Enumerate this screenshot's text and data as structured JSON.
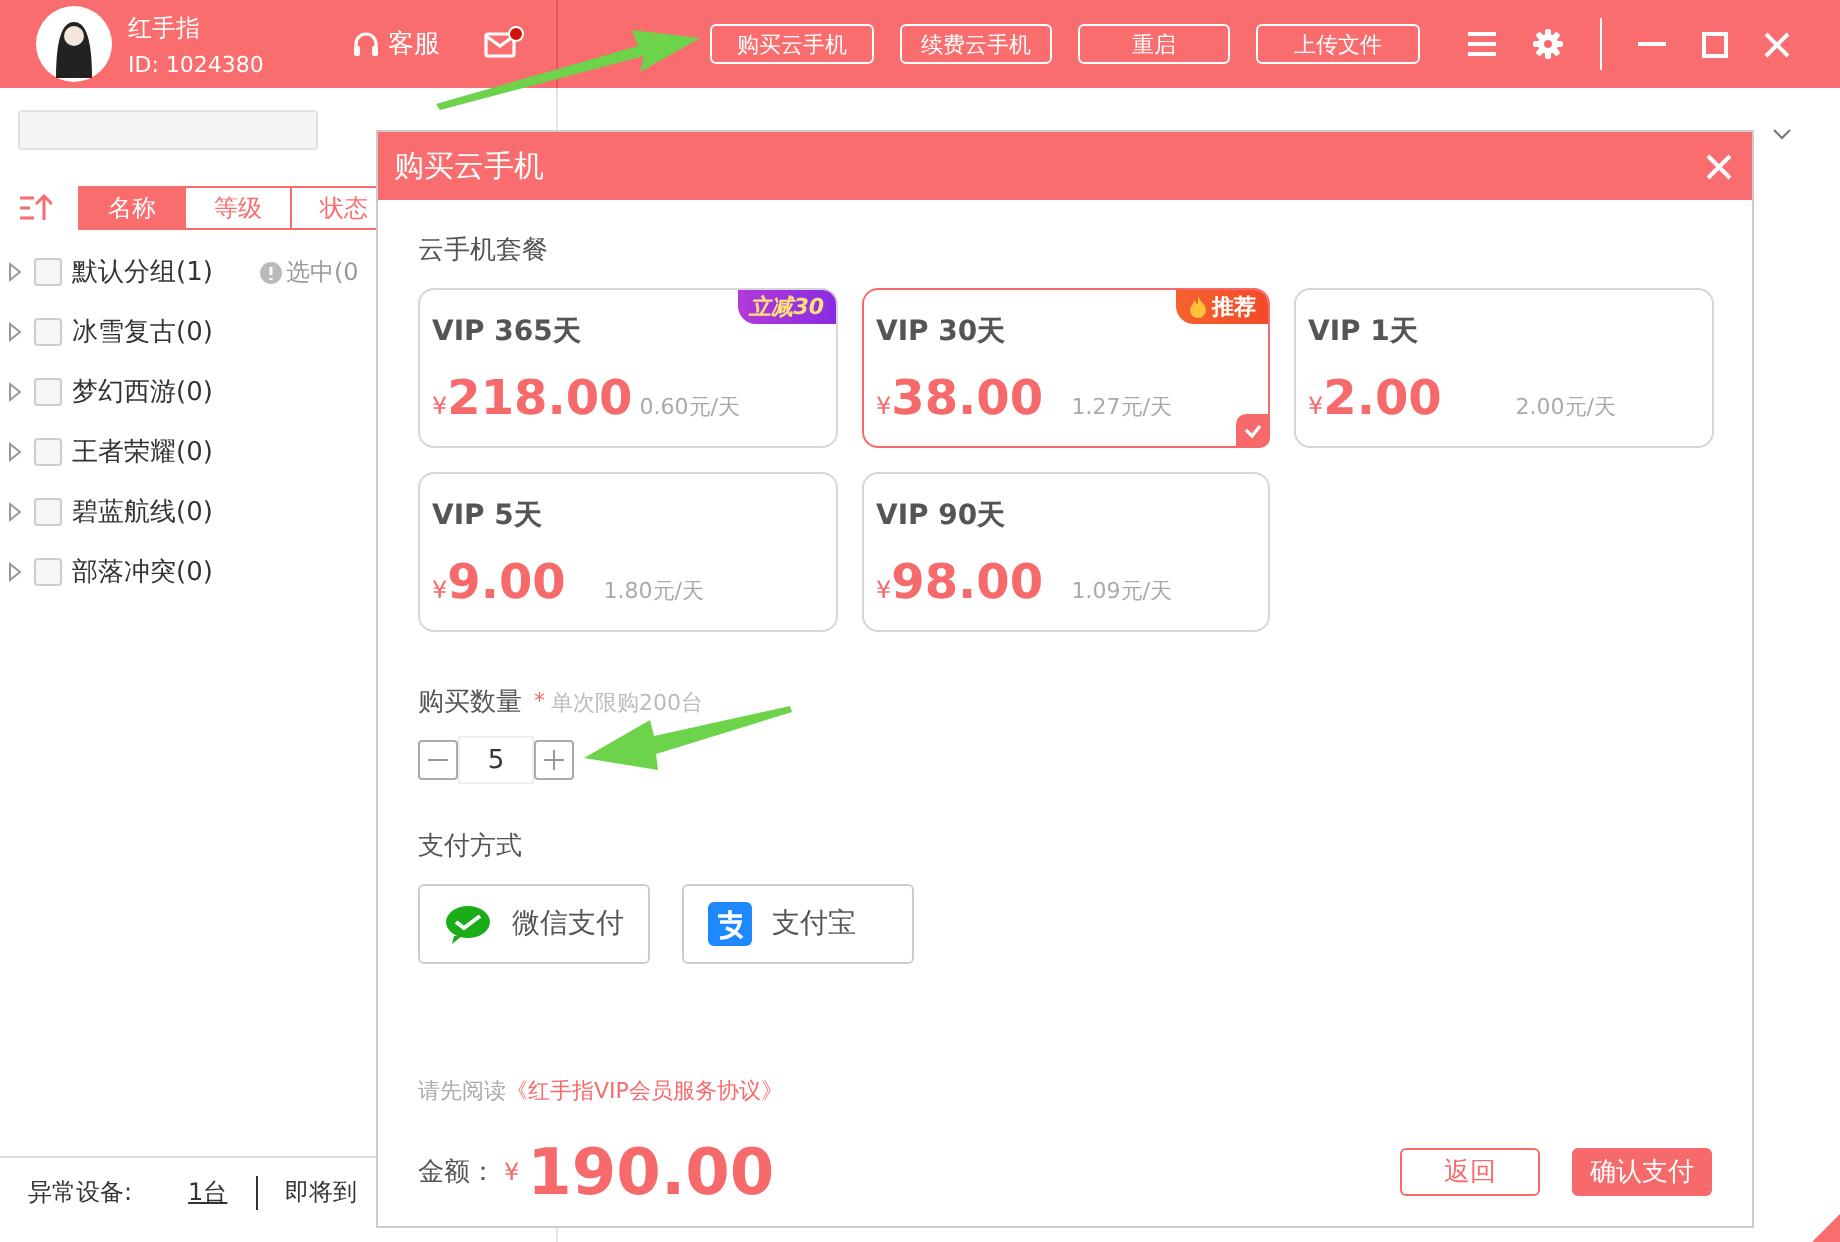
{
  "app_header": {
    "user_name": "红手指",
    "user_id": "ID: 1024380",
    "support": "客服",
    "mail_unread": true,
    "buttons": [
      "购买云手机",
      "续费云手机",
      "重启",
      "上传文件"
    ]
  },
  "sidebar": {
    "sort_tabs": [
      {
        "label": "名称",
        "selected": true
      },
      {
        "label": "等级",
        "selected": false
      },
      {
        "label": "状态",
        "selected": false
      }
    ],
    "groups": [
      {
        "label": "默认分组(1)",
        "checked": false,
        "selection": "选中(0"
      },
      {
        "label": "冰雪复古(0)",
        "checked": false
      },
      {
        "label": "梦幻西游(0)",
        "checked": false
      },
      {
        "label": "王者荣耀(0)",
        "checked": false
      },
      {
        "label": "碧蓝航线(0)",
        "checked": false
      },
      {
        "label": "部落冲突(0)",
        "checked": false
      }
    ],
    "footer": {
      "label": "异常设备:",
      "count": "1台",
      "next": "即将到"
    }
  },
  "dialog": {
    "title": "购买云手机",
    "packages_label": "云手机套餐",
    "packages": [
      {
        "name": "VIP 365天",
        "currency": "¥",
        "price": "218.00",
        "per_day": "0.60元/天",
        "selected": false,
        "badge": {
          "kind": "discount",
          "text": "立减30"
        }
      },
      {
        "name": "VIP 30天",
        "currency": "¥",
        "price": "38.00",
        "per_day": "1.27元/天",
        "selected": true,
        "badge": {
          "kind": "recommend",
          "text": "推荐"
        }
      },
      {
        "name": "VIP 1天",
        "currency": "¥",
        "price": "2.00",
        "per_day": "2.00元/天",
        "selected": false
      },
      {
        "name": "VIP 5天",
        "currency": "¥",
        "price": "9.00",
        "per_day": "1.80元/天",
        "selected": false
      },
      {
        "name": "VIP 90天",
        "currency": "¥",
        "price": "98.00",
        "per_day": "1.09元/天",
        "selected": false
      }
    ],
    "quantity": {
      "label": "购买数量",
      "required_mark": "*",
      "hint": "单次限购200台",
      "value": "5"
    },
    "payment": {
      "label": "支付方式",
      "methods": [
        {
          "kind": "wechat",
          "label": "微信支付"
        },
        {
          "kind": "alipay",
          "label": "支付宝"
        }
      ]
    },
    "agreement": {
      "prefix": "请先阅读",
      "link": "《红手指VIP会员服务协议》"
    },
    "total": {
      "label": "金额：",
      "currency": "¥",
      "amount": "190.00"
    },
    "buttons": [
      {
        "kind": "secondary",
        "label": "返回"
      },
      {
        "kind": "primary",
        "label": "确认支付"
      }
    ]
  }
}
